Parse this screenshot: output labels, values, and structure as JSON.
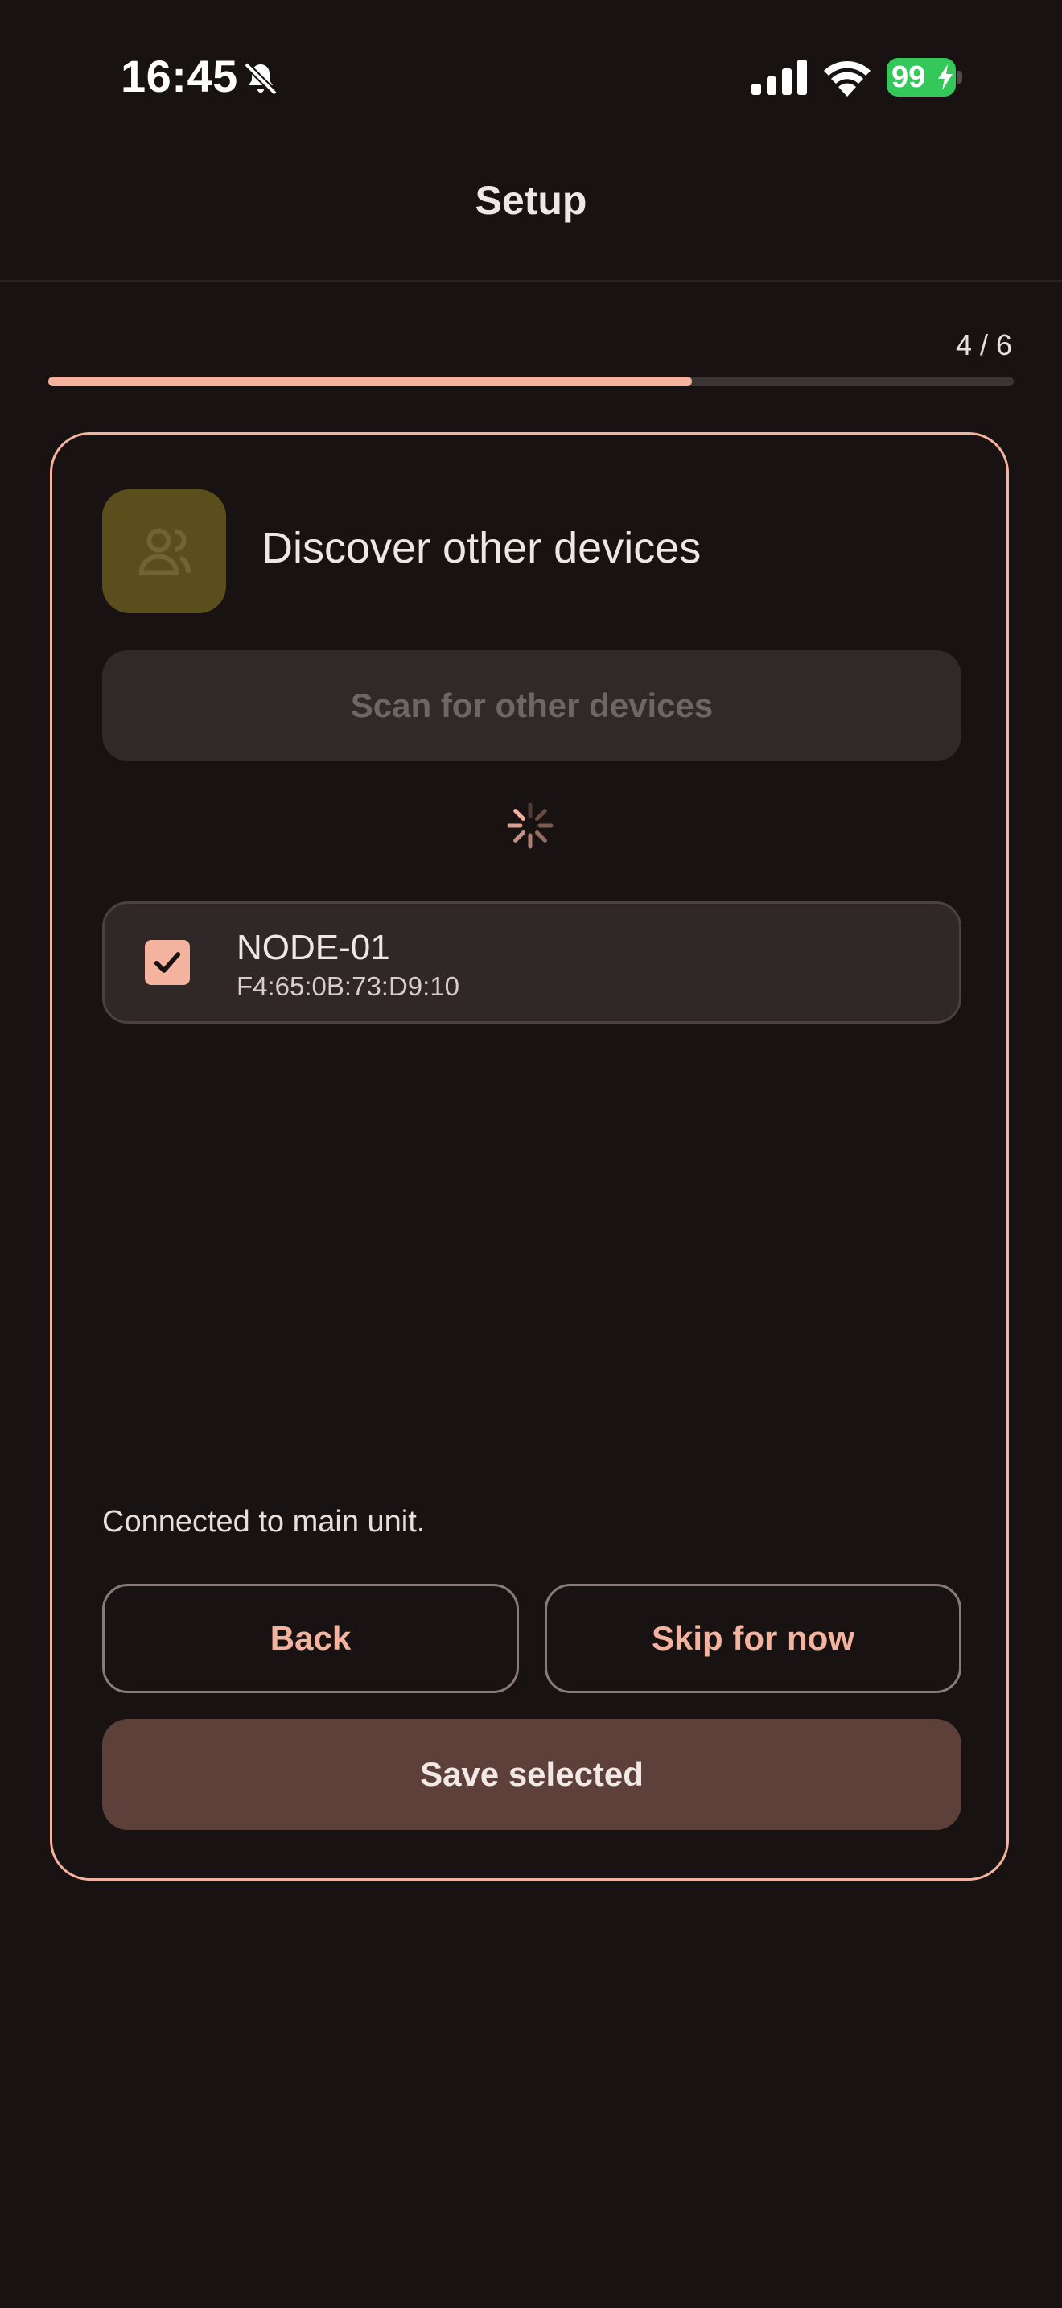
{
  "status_bar": {
    "time": "16:45",
    "battery": "99",
    "icons": [
      "bell-slash-icon",
      "cellular-signal-icon",
      "wifi-icon",
      "battery-charging-icon"
    ]
  },
  "header": {
    "title": "Setup"
  },
  "progress": {
    "label": "4 / 6",
    "fraction": 0.667,
    "color": "#f4b39e"
  },
  "card": {
    "icon": "person-group-icon",
    "title": "Discover other devices",
    "scan_button": "Scan for other devices",
    "spinner_icon": "loading-spinner-icon",
    "devices": [
      {
        "name": "NODE-01",
        "mac": "F4:65:0B:73:D9:10",
        "checked": true
      }
    ],
    "status_message": "Connected to main unit.",
    "back_button": "Back",
    "skip_button": "Skip for now",
    "save_button": "Save selected"
  },
  "colors": {
    "background": "#181312",
    "accent": "#f4b39e",
    "save_button_bg": "#5c4039",
    "battery": "#34c759"
  }
}
